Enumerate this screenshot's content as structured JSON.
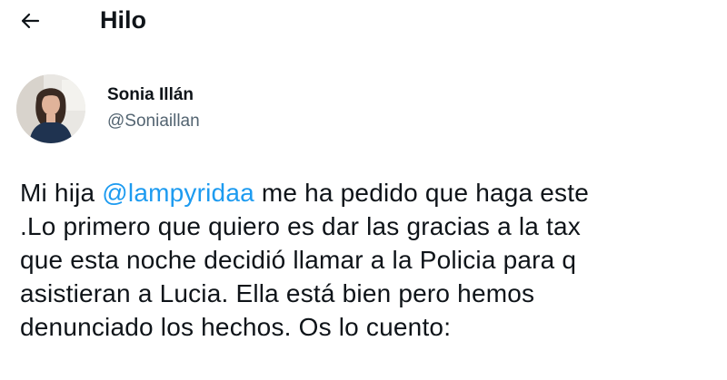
{
  "header": {
    "back_icon": "arrow-left-icon",
    "title": "Hilo"
  },
  "tweet": {
    "author": {
      "name": "Sonia Illán",
      "handle": "@Soniaillan"
    },
    "text": {
      "line1_prefix": "Mi hija ",
      "mention": "@lampyridaa",
      "line1_suffix": " me ha pedido que haga este",
      "line2": ".Lo primero que quiero es dar las gracias a la tax",
      "line3": "que esta noche decidió llamar a la Policia  para q",
      "line4": "asistieran  a Lucia. Ella está bien pero hemos",
      "line5": "denunciado los hechos. Os lo cuento:"
    }
  },
  "colors": {
    "text": "#0f1419",
    "secondary": "#536471",
    "link": "#1d9bf0",
    "background": "#ffffff"
  }
}
